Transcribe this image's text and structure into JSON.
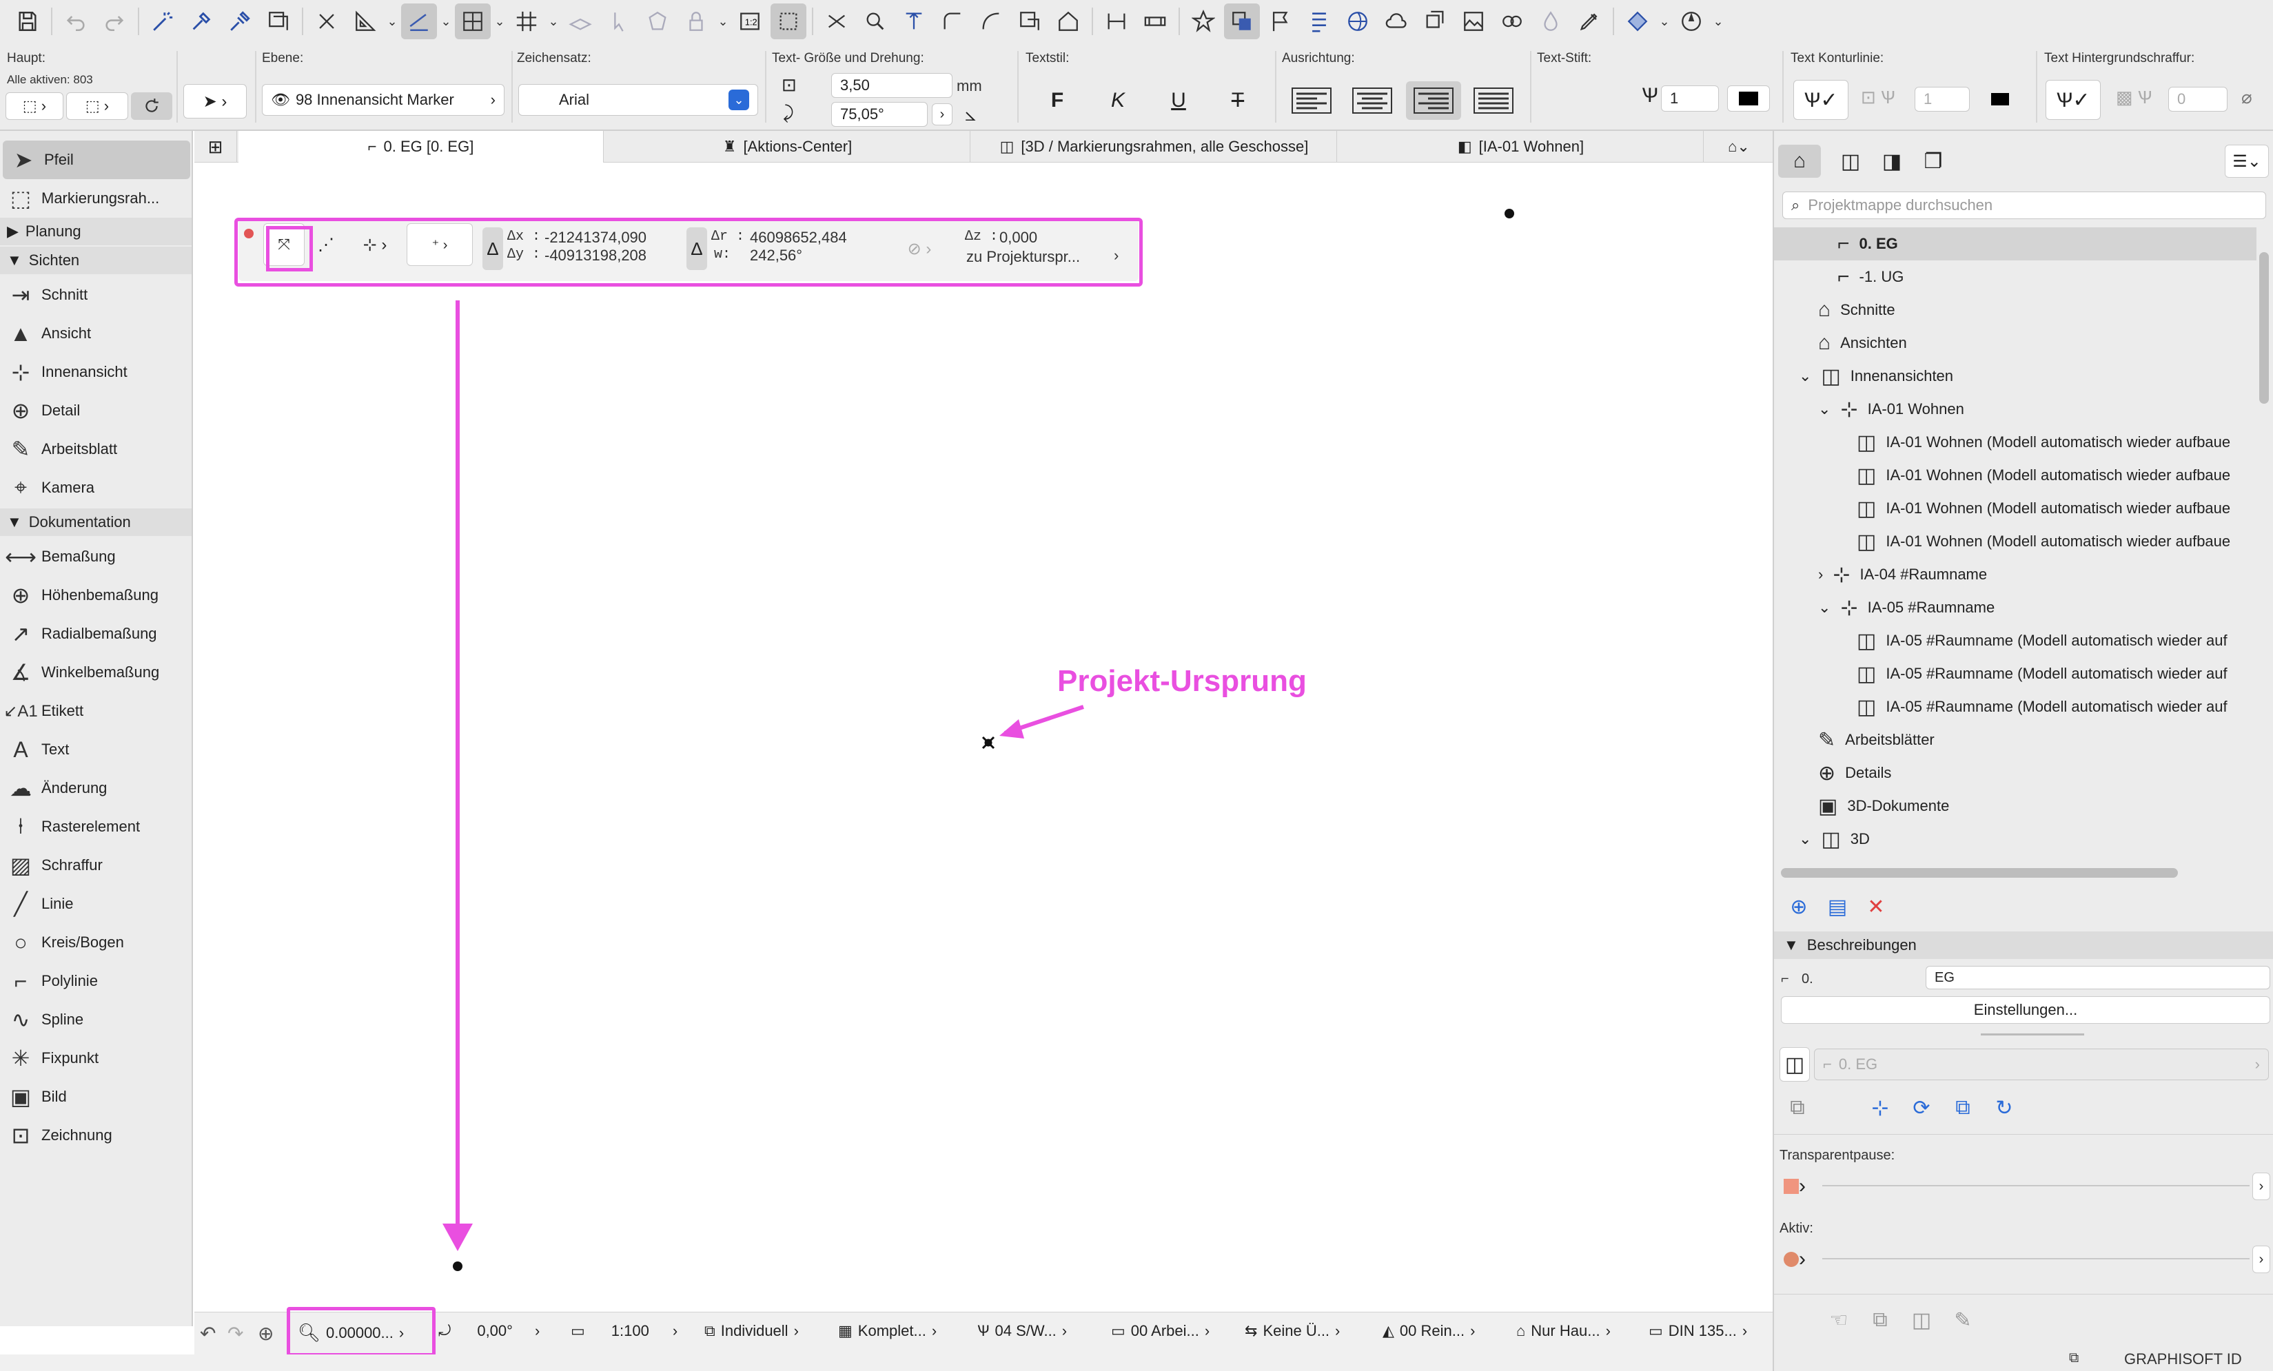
{
  "toolbar": {
    "icons": [
      "save-icon",
      "undo-icon",
      "redo-icon",
      "magic-wand-icon",
      "eyedropper-icon",
      "syringe-icon",
      "trim-icon",
      "mirror-icon",
      "drafting-triangle-icon",
      "rotate-icon",
      "snap-guide-icon",
      "grid-snap-icon",
      "layer-icon",
      "arrow-icon",
      "polygon-icon",
      "lock-icon",
      "renovation-icon",
      "marquee-icon",
      "split-icon",
      "adjust-icon",
      "offset-icon",
      "fillet-icon",
      "curve-icon",
      "stretch-icon",
      "house-icon",
      "dimension-icon",
      "bridge-icon",
      "favorite-star-icon",
      "layers-stack-icon",
      "flag-icon",
      "list-icon",
      "globe-icon",
      "cloud-icon",
      "trace-icon",
      "image-icon",
      "teamwork-icon",
      "drop-icon",
      "pencil-icon",
      "settings-icon",
      "target-icon"
    ]
  },
  "info": {
    "haupt_label": "Haupt:",
    "alle_aktiven": "Alle aktiven: 803",
    "ebene_label": "Ebene:",
    "ebene_value": "98 Innenansicht Marker",
    "zeichensatz_label": "Zeichensatz:",
    "font_value": "Arial",
    "textsize_label": "Text- Größe und Drehung:",
    "text_size": "3,50",
    "unit_mm": "mm",
    "rotation": "75,05°",
    "textstil_label": "Textstil:",
    "style_bold": "F",
    "style_italic": "K",
    "style_underline": "U",
    "style_strike": "T",
    "ausrichtung_label": "Ausrichtung:",
    "textstift_label": "Text-Stift:",
    "pen_value": "1",
    "kontur_label": "Text Konturlinie:",
    "kontur_value": "1",
    "hinter_label": "Text Hintergrundschraffur:",
    "hinter_value": "0"
  },
  "left_panel": {
    "pfeil": "Pfeil",
    "markierung": "Markierungsrah...",
    "sections": {
      "planung": "Planung",
      "sichten": "Sichten",
      "dokumentation": "Dokumentation"
    },
    "sichten_items": [
      "Schnitt",
      "Ansicht",
      "Innenansicht",
      "Detail",
      "Arbeitsblatt",
      "Kamera"
    ],
    "doku_items": [
      "Bemaßung",
      "Höhenbemaßung",
      "Radialbemaßung",
      "Winkelbemaßung",
      "Etikett",
      "Text",
      "Änderung",
      "Rasterelement",
      "Schraffur",
      "Linie",
      "Kreis/Bogen",
      "Polylinie",
      "Spline",
      "Fixpunkt",
      "Bild",
      "Zeichnung"
    ]
  },
  "tabs": [
    "0. EG [0. EG]",
    "[Aktions-Center]",
    "[3D / Markierungsrahmen, alle Geschosse]",
    "[IA-01 Wohnen]"
  ],
  "coord": {
    "dx_label": "∆x :",
    "dy_label": "∆y :",
    "dx": "-21241374,090",
    "dy": "-40913198,208",
    "dr_label": "∆r :",
    "w_label": "w:",
    "dr": "46098652,484",
    "w": "242,56°",
    "dz_label": "∆z :",
    "dz": "0,000",
    "ref": "zu Projekturspr..."
  },
  "annotation": {
    "label": "Projekt-Ursprung",
    "color": "#e94fe0"
  },
  "statusbar": {
    "zoom": "0.00000...",
    "angle": "0,00°",
    "scale": "1:100",
    "layers": "Individuell",
    "model": "Komplet...",
    "pen": "04 S/W...",
    "view": "00 Arbei...",
    "override": "Keine Ü...",
    "renov": "00 Rein...",
    "struct": "Nur Hau...",
    "dim": "DIN 135..."
  },
  "navigator": {
    "search_placeholder": "Projektmappe durchsuchen",
    "tree": [
      "0. EG",
      "-1. UG",
      "Schnitte",
      "Ansichten",
      "Innenansichten",
      "IA-01 Wohnen",
      "IA-01 Wohnen (Modell automatisch wieder aufbaue",
      "IA-01 Wohnen (Modell automatisch wieder aufbaue",
      "IA-01 Wohnen (Modell automatisch wieder aufbaue",
      "IA-01 Wohnen (Modell automatisch wieder aufbaue",
      "IA-04 #Raumname",
      "IA-05 #Raumname",
      "IA-05 #Raumname (Modell automatisch wieder auf",
      "IA-05 #Raumname (Modell automatisch wieder auf",
      "IA-05 #Raumname (Modell automatisch wieder auf",
      "Arbeitsblätter",
      "Details",
      "3D-Dokumente",
      "3D"
    ],
    "beschreibungen": "Beschreibungen",
    "desc_key": "0.",
    "desc_val": "EG",
    "einstellungen": "Einstellungen...",
    "layout_value": "0. EG",
    "transparent_label": "Transparentpause:",
    "aktiv_label": "Aktiv:",
    "brand": "GRAPHISOFT ID"
  }
}
